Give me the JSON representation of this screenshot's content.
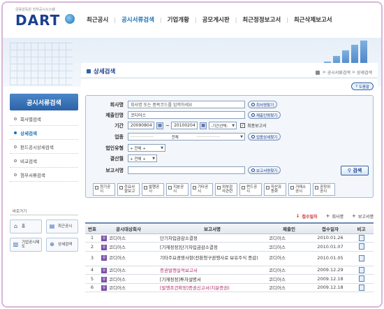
{
  "header": {
    "logo_subtitle": "금융감독원 전자공시시스템",
    "logo": "DART",
    "nav": [
      "최근공시",
      "공시서류검색",
      "기업개황",
      "공모게시판",
      "최근정정보고서",
      "최근삭제보고서"
    ]
  },
  "sidebar": {
    "title": "공시서류검색",
    "items": [
      "회사별검색",
      "상세검색",
      "펀드공시상세검색",
      "비교검색",
      "첨부서류검색"
    ],
    "shortcuts_label": "바로가기",
    "shortcuts": [
      "홈",
      "최근공시",
      "기업공시제도",
      "상세검색"
    ]
  },
  "page": {
    "title": "상세검색",
    "breadcrumb": [
      "공시서류검색",
      "상세검색"
    ],
    "help": "도움말"
  },
  "form": {
    "company_label": "회사명",
    "company_placeholder": "회사명 또는 종목코드를 입력하세요",
    "company_btn": "회사명찾기",
    "submitter_label": "제출인명",
    "submitter_value": "코디어스",
    "submitter_btn": "제출인명찾기",
    "period_label": "기간",
    "period_from": "20090804",
    "period_to": "20100204",
    "period_select": "-기간선택-",
    "final_report_label": "최종보고서",
    "industry_label": "업종",
    "industry_select": "전체",
    "industry_btn": "업종상세찾기",
    "corp_type_label": "법인유형",
    "corp_type_select": "전체",
    "settle_label": "결산월",
    "settle_select": "전체",
    "report_label": "보고서명",
    "report_btn": "보고서명찾기",
    "search_btn": "검색",
    "types": [
      "정기공시",
      "주요사항보고",
      "발행공시",
      "지분공시",
      "기타공시",
      "외부감사관련",
      "펀드공시",
      "자산유동화",
      "거래소공시",
      "공정위공시"
    ]
  },
  "toolbar": [
    "접수일자",
    "회사명",
    "보고서명"
  ],
  "table": {
    "headers": [
      "번호",
      "공시대상회사",
      "보고서명",
      "제출인",
      "접수일자",
      "비고"
    ],
    "rows": [
      {
        "no": "1",
        "company": "코디어스",
        "report": "단기차입금감소결정",
        "submitter": "코디어스",
        "date": "2010.01.26"
      },
      {
        "no": "2",
        "company": "코디어스",
        "report": "[기재정정]단기차입금감소결정",
        "submitter": "코디어스",
        "date": "2010.01.07"
      },
      {
        "no": "3",
        "company": "코디어스",
        "report": "기타주요경영사항(전환청구권행사로 보유주식 증감)",
        "submitter": "코디어스",
        "date": "2010.01.05"
      },
      {
        "no": "4",
        "company": "코디어스",
        "report": "증권발행실적보고서",
        "submitter": "코디어스",
        "date": "2009.12.29"
      },
      {
        "no": "5",
        "company": "코디어스",
        "report": "[기재정정]투자설명서",
        "submitter": "코디어스",
        "date": "2009.12.18"
      },
      {
        "no": "6",
        "company": "코디어스",
        "report": "[발행조건확정]증권신고서(지분증권)",
        "submitter": "코디어스",
        "date": "2009.12.18"
      }
    ]
  },
  "colors": {
    "brand": "#1a3f8f",
    "accent": "#2d63a8",
    "frame": "#d8b6d8"
  }
}
